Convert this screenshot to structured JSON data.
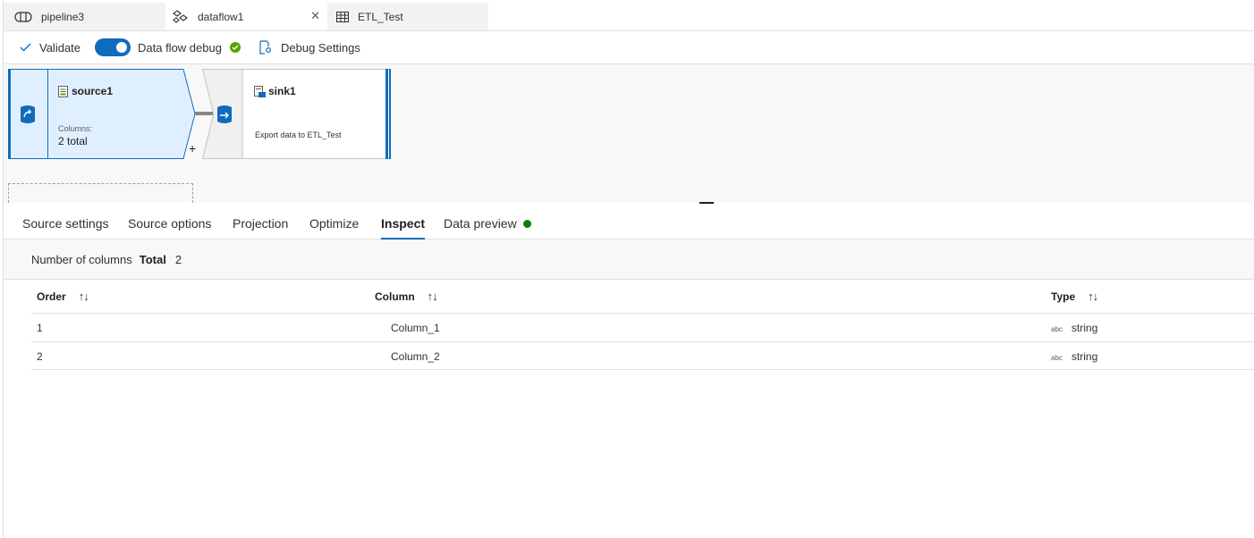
{
  "tabs": [
    {
      "label": "pipeline3",
      "icon": "pipeline-icon",
      "active": false
    },
    {
      "label": "dataflow1",
      "icon": "dataflow-icon",
      "active": true
    },
    {
      "label": "ETL_Test",
      "icon": "table-icon",
      "active": false
    }
  ],
  "toolbar": {
    "validate_label": "Validate",
    "debug_label": "Data flow debug",
    "debug_on": true,
    "debug_settings_label": "Debug Settings"
  },
  "canvas": {
    "source": {
      "name": "source1",
      "columns_label": "Columns:",
      "columns_value": "2 total"
    },
    "add_symbol": "+",
    "sink": {
      "name": "sink1",
      "description": "Export data to ETL_Test"
    }
  },
  "property_tabs": [
    {
      "label": "Source settings",
      "active": false
    },
    {
      "label": "Source options",
      "active": false
    },
    {
      "label": "Projection",
      "active": false
    },
    {
      "label": "Optimize",
      "active": false
    },
    {
      "label": "Inspect",
      "active": true
    },
    {
      "label": "Data preview",
      "active": false
    }
  ],
  "summary": {
    "label": "Number of columns",
    "total_label": "Total",
    "total_value": "2"
  },
  "table": {
    "headers": [
      "Order",
      "Column",
      "Type"
    ],
    "rows": [
      {
        "order": "1",
        "column": "Column_1",
        "type_badge": "abc",
        "type": "string"
      },
      {
        "order": "2",
        "column": "Column_2",
        "type_badge": "abc",
        "type": "string"
      }
    ]
  },
  "colors": {
    "accent": "#0f6cbd",
    "ok": "#57a300",
    "status_green": "#107c10"
  }
}
